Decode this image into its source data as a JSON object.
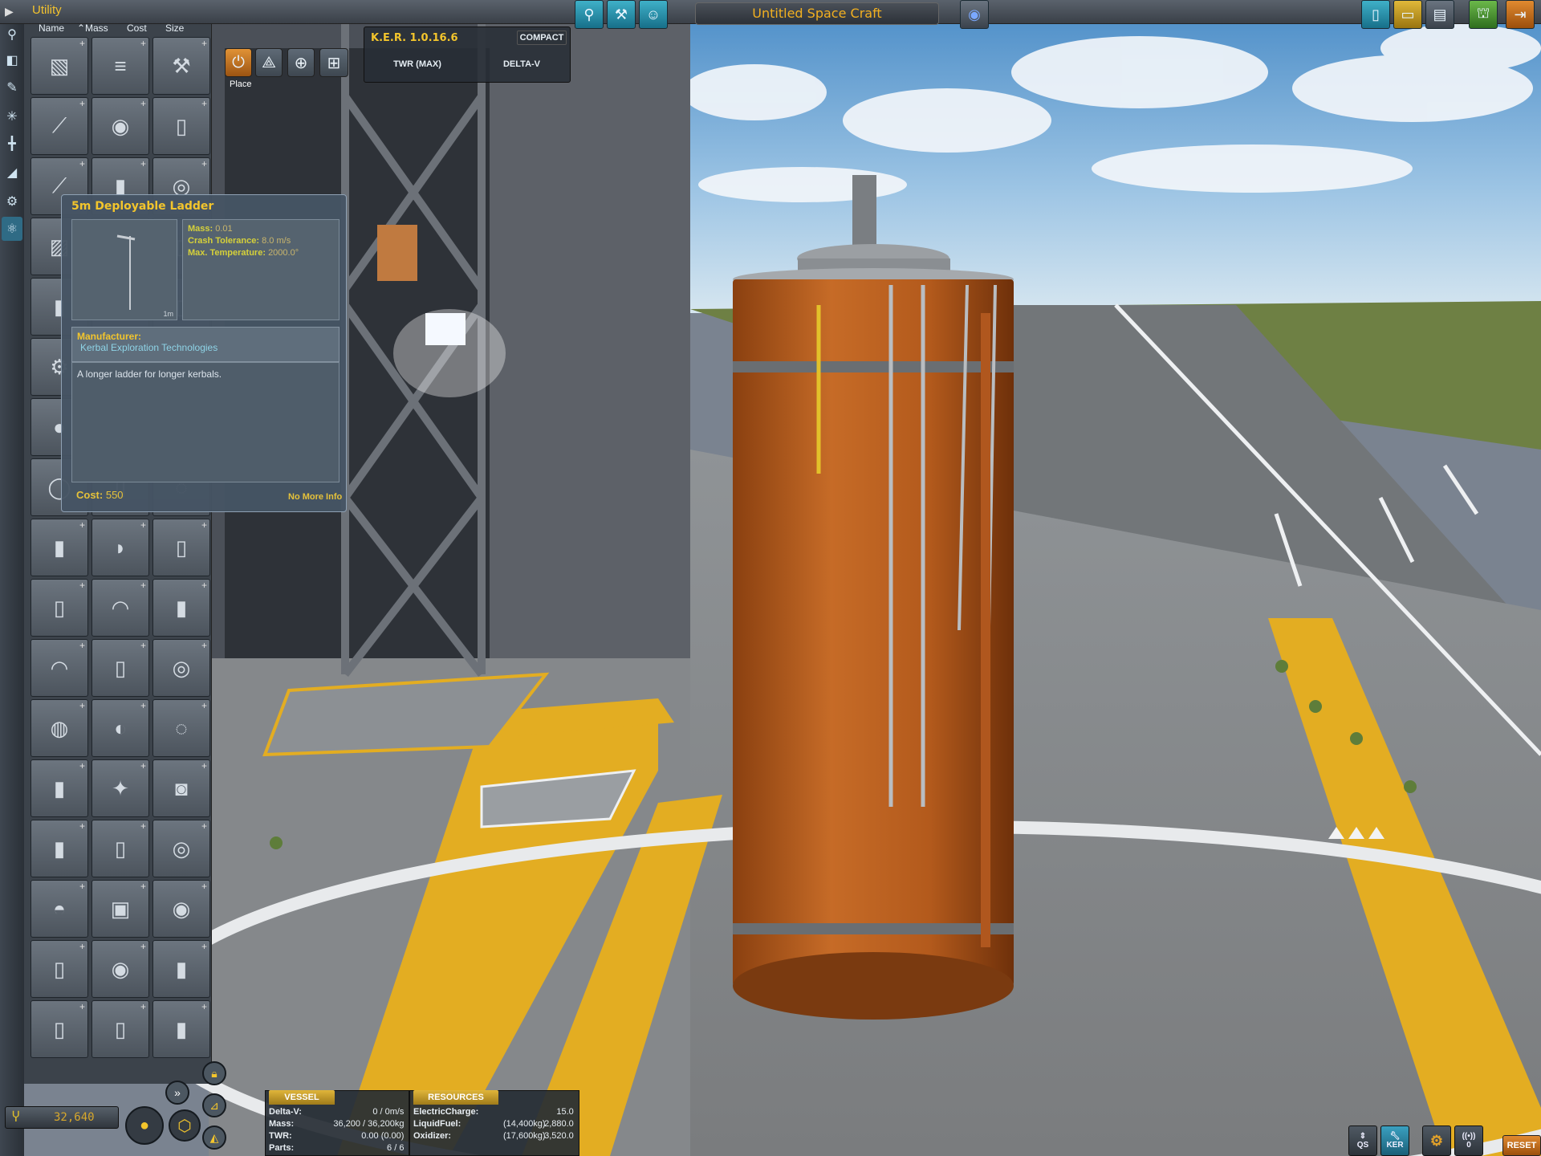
{
  "app": {
    "category_title": "Utility",
    "craft_name": "Untitled Space Craft",
    "funds": "32,640"
  },
  "sort_headers": {
    "name": "Name",
    "mass": "Mass",
    "cost": "Cost",
    "size": "Size"
  },
  "part_grid": {
    "rows": 17,
    "cols": 3
  },
  "tooltip": {
    "title": "5m Deployable Ladder",
    "image_scale": "1m",
    "stats": [
      {
        "label": "Mass:",
        "value": "0.01"
      },
      {
        "label": "Crash Tolerance:",
        "value": "8.0 m/s"
      },
      {
        "label": "Max. Temperature:",
        "value": "2000.0°"
      }
    ],
    "manufacturer_label": "Manufacturer:",
    "manufacturer": "Kerbal Exploration Technologies",
    "description": "A longer ladder for longer kerbals.",
    "cost_label": "Cost:",
    "cost_value": "550",
    "more_info": "No More Info"
  },
  "gizmo": {
    "place_label": "Place"
  },
  "ker": {
    "title": "K.E.R. 1.0.16.6",
    "compact": "COMPACT",
    "twr": "TWR (MAX)",
    "delta_v": "DELTA-V"
  },
  "vessel": {
    "tab": "VESSEL",
    "rows": [
      {
        "label": "Delta-V:",
        "value": "0 / 0m/s"
      },
      {
        "label": "Mass:",
        "value": "36,200 / 36,200kg"
      },
      {
        "label": "TWR:",
        "value": "0.00 (0.00)"
      },
      {
        "label": "Parts:",
        "value": "6 / 6"
      }
    ]
  },
  "resources": {
    "tab": "RESOURCES",
    "rows": [
      {
        "label": "ElectricCharge:",
        "mass": "",
        "value": "15.0"
      },
      {
        "label": "LiquidFuel:",
        "mass": "(14,400kg)",
        "value": "2,880.0"
      },
      {
        "label": "Oxidizer:",
        "mass": "(17,600kg)",
        "value": "3,520.0"
      }
    ]
  },
  "bottom_right": {
    "qs": "QS",
    "ker": "KER",
    "count": "0",
    "reset": "RESET"
  },
  "colors": {
    "accent": "#f3c52c",
    "tank_orange": "#c4651f",
    "tarmac": "#8b8e91",
    "stripe": "#e3ad22"
  }
}
